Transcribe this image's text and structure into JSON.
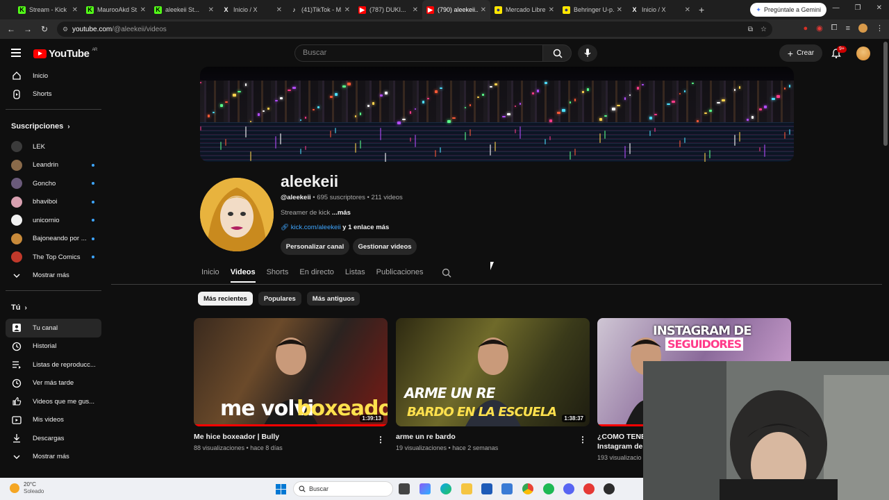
{
  "browser": {
    "tabs": [
      {
        "label": "Stream - Kick",
        "fav": "K",
        "color": "#53fc18",
        "text": "#000"
      },
      {
        "label": "MaurooAkd St...",
        "fav": "K",
        "color": "#53fc18",
        "text": "#000"
      },
      {
        "label": "aleekeii St...",
        "fav": "K",
        "color": "#53fc18",
        "text": "#000"
      },
      {
        "label": "Inicio / X",
        "fav": "X",
        "color": "#1f1f1f",
        "text": "#fff"
      },
      {
        "label": "(41)TikTok - M...",
        "fav": "♪",
        "color": "#1f1f1f",
        "text": "#fff"
      },
      {
        "label": "(787) DUKI...",
        "fav": "▶",
        "color": "#ff0000",
        "text": "#fff"
      },
      {
        "label": "(790) aleekeii...",
        "fav": "▶",
        "color": "#ff0000",
        "text": "#fff"
      },
      {
        "label": "Mercado Libre...",
        "fav": "●",
        "color": "#ffe600",
        "text": "#2d3277"
      },
      {
        "label": "Behringer U-p...",
        "fav": "●",
        "color": "#ffe600",
        "text": "#2d3277"
      },
      {
        "label": "Inicio / X",
        "fav": "X",
        "color": "#1f1f1f",
        "text": "#fff"
      }
    ],
    "gemini_label": "Pregúntale a Gemini",
    "url_host": "youtube.com",
    "url_path": "/@aleekeii/videos"
  },
  "header": {
    "logo_text": "YouTube",
    "region": "AR",
    "search_placeholder": "Buscar",
    "create_label": "Crear",
    "notif_count": "9+"
  },
  "sidebar": {
    "main": [
      {
        "label": "Inicio",
        "icon": "home-icon"
      },
      {
        "label": "Shorts",
        "icon": "shorts-icon"
      }
    ],
    "subs_title": "Suscripciones",
    "subs": [
      {
        "label": "LEK",
        "color": "#3b3b3b",
        "dot": false
      },
      {
        "label": "Leandrin",
        "color": "#8a6a4a",
        "dot": true
      },
      {
        "label": "Goncho",
        "color": "#6a5a7a",
        "dot": true
      },
      {
        "label": "bhaviboi",
        "color": "#d8a0b0",
        "dot": true
      },
      {
        "label": "unicornio",
        "color": "#f1f1f1",
        "dot": true
      },
      {
        "label": "Bajoneando por ...",
        "color": "#c88a3a",
        "dot": true
      },
      {
        "label": "The Top Comics",
        "color": "#c0392b",
        "dot": true
      }
    ],
    "subs_more": "Mostrar más",
    "you_title": "Tú",
    "you": [
      {
        "label": "Tu canal",
        "icon": "channel-icon",
        "sel": true
      },
      {
        "label": "Historial",
        "icon": "history-icon",
        "sel": false
      },
      {
        "label": "Listas de reproducc...",
        "icon": "playlists-icon",
        "sel": false
      },
      {
        "label": "Ver más tarde",
        "icon": "watch-later-icon",
        "sel": false
      },
      {
        "label": "Videos que me gus...",
        "icon": "like-icon",
        "sel": false
      },
      {
        "label": "Mis videos",
        "icon": "my-videos-icon",
        "sel": false
      },
      {
        "label": "Descargas",
        "icon": "download-icon",
        "sel": false
      },
      {
        "label": "Mostrar más",
        "icon": "chevron-down-icon",
        "sel": false
      }
    ]
  },
  "channel": {
    "name": "aleekeii",
    "handle": "@aleekeii",
    "stats": " • 695 suscriptores • 211 videos",
    "desc": "Streamer de kick ",
    "desc_more": "...más",
    "link": "kick.com/aleekeii",
    "link_more": " y 1 enlace más",
    "customize": "Personalizar canal",
    "manage": "Gestionar videos",
    "tabs": [
      "Inicio",
      "Videos",
      "Shorts",
      "En directo",
      "Listas",
      "Publicaciones"
    ],
    "active_tab": 1,
    "chips": [
      "Más recientes",
      "Populares",
      "Más antiguos"
    ]
  },
  "videos": [
    {
      "title": "Me hice boxeador | Bully",
      "meta": "88 visualizaciones • hace 8 días",
      "duration": "1:39:13",
      "overlay1": "me volvi",
      "overlay2": "boxeador",
      "progress": 1.0
    },
    {
      "title": "arme un re bardo",
      "meta": "19 visualizaciones • hace 2 semanas",
      "duration": "1:38:37",
      "overlay1": "ARME UN RE",
      "overlay2": "BARDO EN LA ESCUELA",
      "progress": 0
    },
    {
      "title": "¿COMO TENE",
      "title2": "Instagram de",
      "meta": "193 visualizacio",
      "duration": "",
      "overlay1": "INSTAGRAM DE",
      "overlay2": "SEGUIDORES",
      "progress": 0.25
    }
  ],
  "taskbar": {
    "temp": "20°C",
    "weather": "Soleado",
    "search": "Buscar"
  }
}
